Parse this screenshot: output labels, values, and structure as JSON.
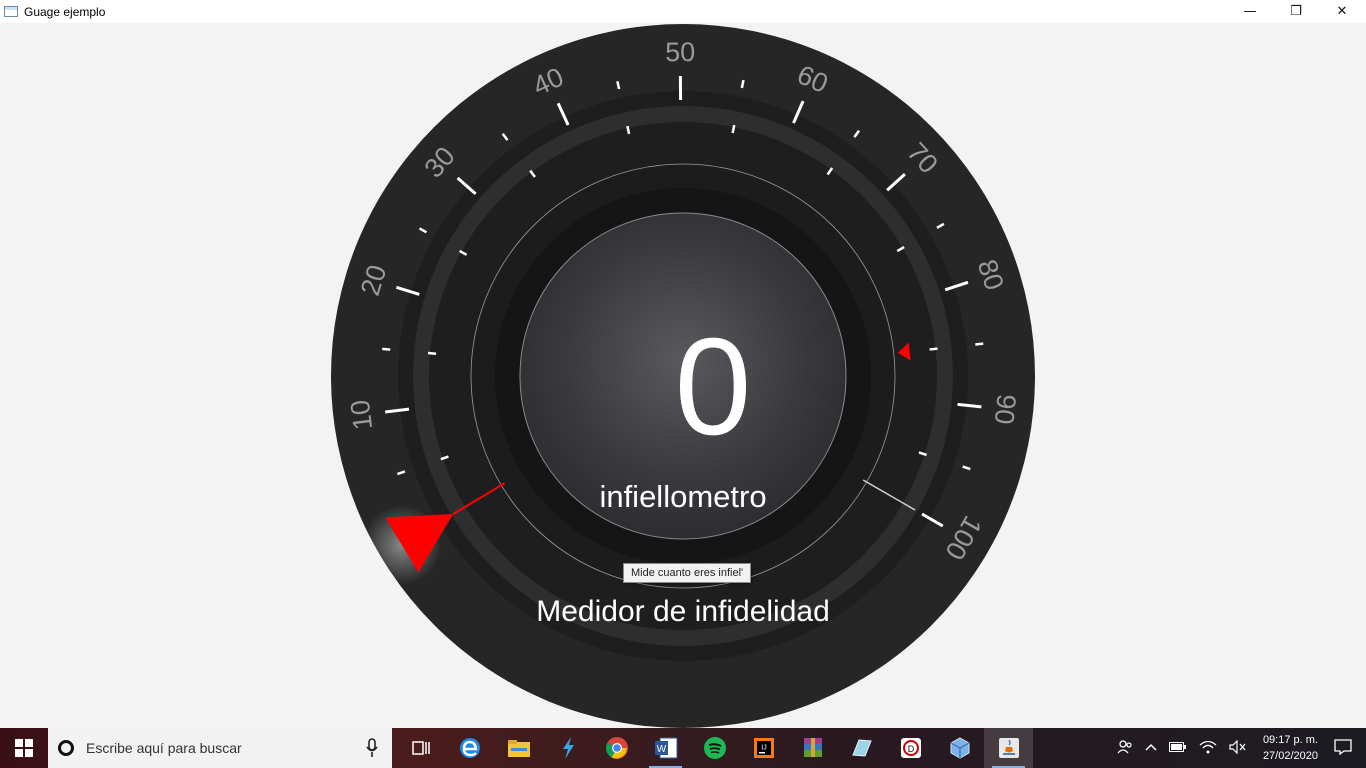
{
  "window": {
    "title": "Guage ejemplo",
    "minimize_glyph": "—",
    "restore_glyph": "❐",
    "close_glyph": "✕"
  },
  "gauge": {
    "value": "0",
    "unit_label": "infiellometro",
    "title": "Medidor de infidelidad",
    "tooltip": "Mide cuanto eres infiel'",
    "min": 0,
    "max": 100,
    "tick_labels": [
      "10",
      "20",
      "30",
      "40",
      "50",
      "60",
      "70",
      "80",
      "90",
      "100"
    ],
    "needle_value": 0,
    "threshold_marker_value": 85,
    "colors": {
      "face": "#262626",
      "needle": "#ff0000",
      "threshold": "#ff0000",
      "ticks": "#ffffff",
      "value_text": "#ffffff"
    }
  },
  "taskbar": {
    "search_placeholder": "Escribe aquí para buscar",
    "apps": [
      {
        "name": "task-view-icon"
      },
      {
        "name": "edge-icon"
      },
      {
        "name": "file-explorer-icon"
      },
      {
        "name": "visual-studio-code-icon"
      },
      {
        "name": "chrome-icon"
      },
      {
        "name": "word-icon"
      },
      {
        "name": "spotify-icon"
      },
      {
        "name": "intellij-icon"
      },
      {
        "name": "winrar-icon"
      },
      {
        "name": "notepad-icon"
      },
      {
        "name": "cmd-icon"
      },
      {
        "name": "virtualbox-icon"
      },
      {
        "name": "java-icon"
      }
    ],
    "clock_time": "09:17 p. m.",
    "clock_date": "27/02/2020"
  }
}
